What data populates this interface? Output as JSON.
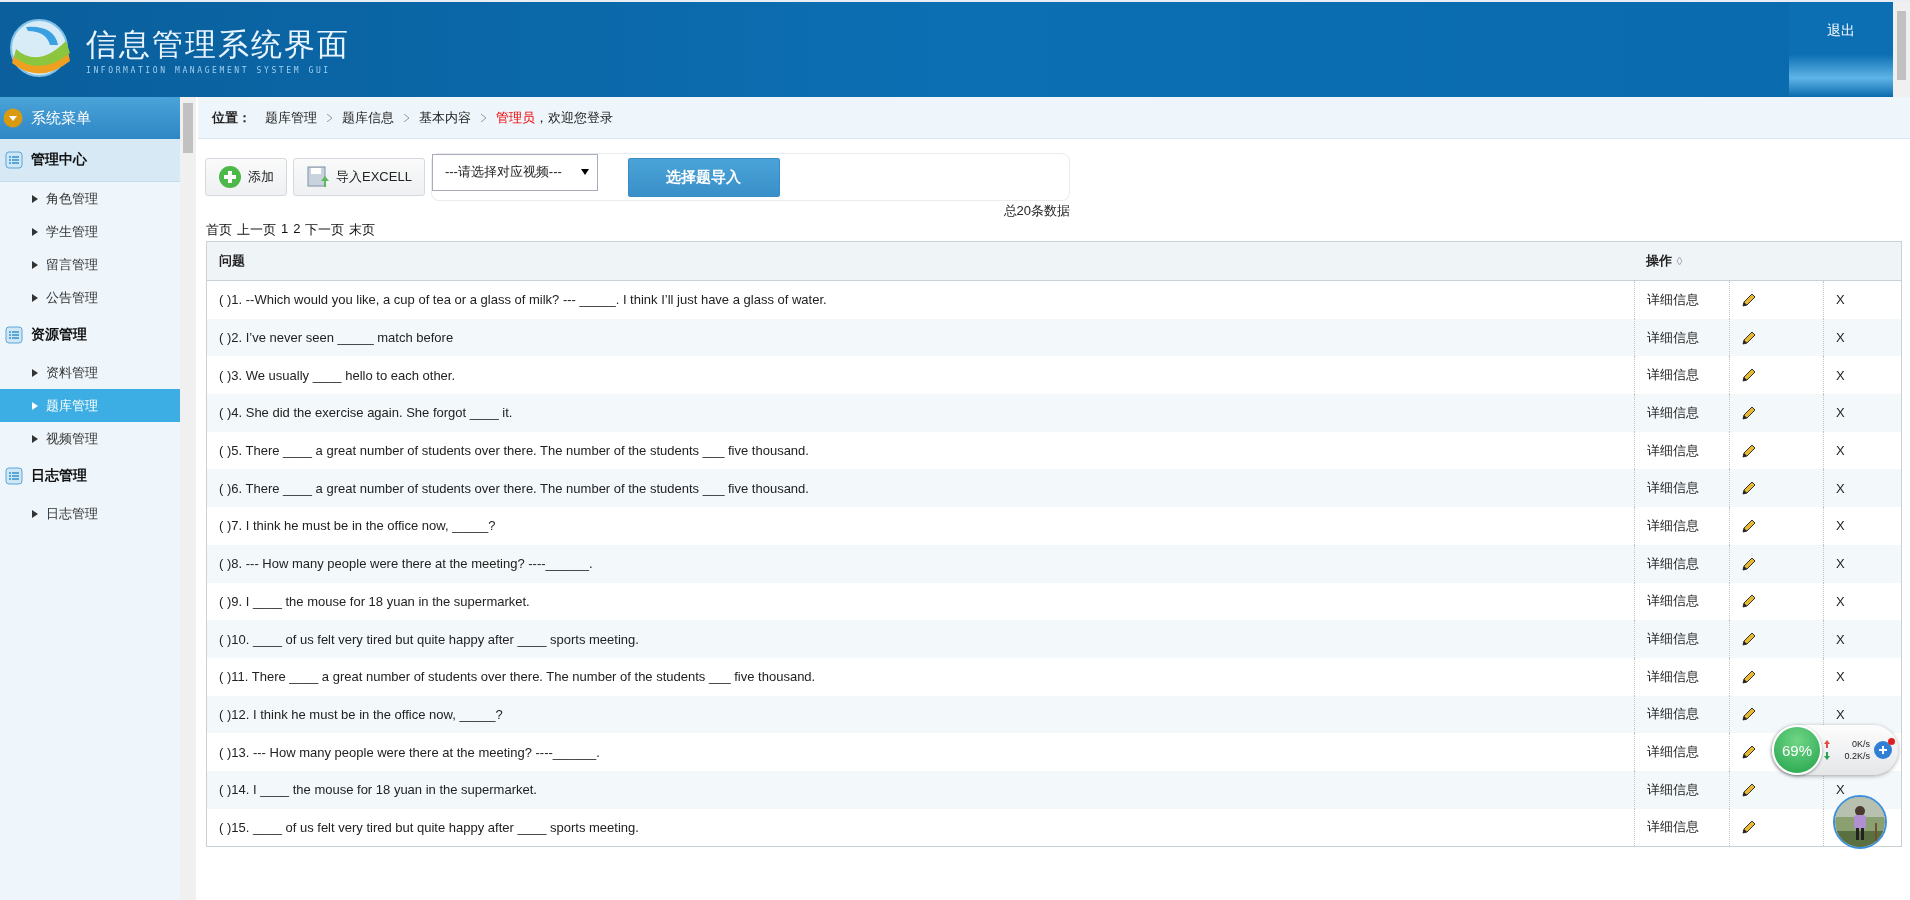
{
  "header": {
    "title": "信息管理系统界面",
    "subtitle": "INFORMATION MANAGEMENT SYSTEM GUI",
    "logout": "退出"
  },
  "sidebar": {
    "title": "系统菜单",
    "groups": [
      {
        "label": "管理中心",
        "highlighted": true,
        "children": [
          {
            "label": "角色管理",
            "selected": false
          },
          {
            "label": "学生管理",
            "selected": false
          },
          {
            "label": "留言管理",
            "selected": false
          },
          {
            "label": "公告管理",
            "selected": false
          }
        ]
      },
      {
        "label": "资源管理",
        "highlighted": false,
        "children": [
          {
            "label": "资料管理",
            "selected": false
          },
          {
            "label": "题库管理",
            "selected": true
          },
          {
            "label": "视频管理",
            "selected": false
          }
        ]
      },
      {
        "label": "日志管理",
        "highlighted": false,
        "children": [
          {
            "label": "日志管理",
            "selected": false
          }
        ]
      }
    ]
  },
  "breadcrumb": {
    "label": "位置：",
    "items": [
      "题库管理",
      "题库信息",
      "基本内容"
    ],
    "user": "管理员",
    "welcome": "，欢迎您登录"
  },
  "toolbar": {
    "add": "添加",
    "import_excel": "导入EXCELL",
    "video_select": {
      "value": "---请选择对应视频---"
    },
    "import_button": "选择题导入"
  },
  "total": "总20条数据",
  "pagination": [
    "首页",
    "上一页",
    "1",
    "2",
    "下一页",
    "末页"
  ],
  "table": {
    "columns": [
      "问题",
      "操作"
    ],
    "rows": [
      {
        "question": "( )1. --Which would you like, a cup of tea or a glass of milk? --- _____. I think I’ll just have a glass of water.",
        "details": "详细信息",
        "delete": "X"
      },
      {
        "question": "( )2. I’ve never seen _____ match before",
        "details": "详细信息",
        "delete": "X"
      },
      {
        "question": "( )3. We usually ____ hello to each other.",
        "details": "详细信息",
        "delete": "X"
      },
      {
        "question": "( )4. She did the exercise again. She forgot ____ it.",
        "details": "详细信息",
        "delete": "X"
      },
      {
        "question": "( )5. There ____ a great number of students over there. The number of the students ___ five thousand.",
        "details": "详细信息",
        "delete": "X"
      },
      {
        "question": "( )6. There ____ a great number of students over there. The number of the students ___ five thousand.",
        "details": "详细信息",
        "delete": "X"
      },
      {
        "question": "( )7. I think he must be in the office now, _____?",
        "details": "详细信息",
        "delete": "X"
      },
      {
        "question": "( )8. --- How many people were there at the meeting? ----______.",
        "details": "详细信息",
        "delete": "X"
      },
      {
        "question": "( )9. I ____ the mouse for 18 yuan in the supermarket.",
        "details": "详细信息",
        "delete": "X"
      },
      {
        "question": "( )10. ____ of us felt very tired but quite happy after ____ sports meeting.",
        "details": "详细信息",
        "delete": "X"
      },
      {
        "question": "( )11. There ____ a great number of students over there. The number of the students ___ five thousand.",
        "details": "详细信息",
        "delete": "X"
      },
      {
        "question": "( )12. I think he must be in the office now, _____?",
        "details": "详细信息",
        "delete": "X"
      },
      {
        "question": "( )13. --- How many people were there at the meeting? ----______.",
        "details": "详细信息"
      },
      {
        "question": "( )14. I ____ the mouse for 18 yuan in the supermarket.",
        "details": "详细信息",
        "delete": "X"
      },
      {
        "question": "( )15. ____ of us felt very tired but quite happy after ____ sports meeting.",
        "details": "详细信息"
      }
    ]
  },
  "speed_widget": {
    "percent": "69%",
    "upload": "0K/s",
    "download": "0.2K/s"
  }
}
